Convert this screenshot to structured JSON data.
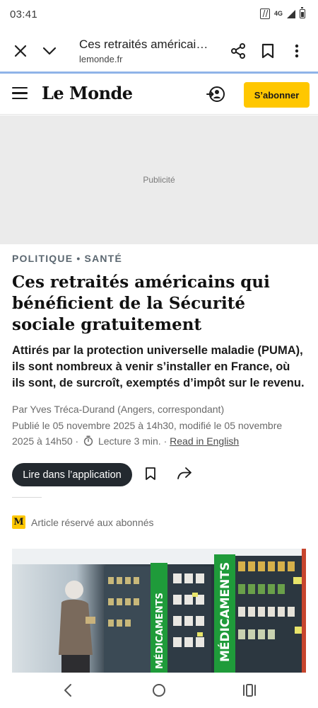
{
  "status_bar": {
    "time": "03:41",
    "network_label": "4G",
    "icons": [
      "nfc-icon",
      "signal-icon",
      "battery-icon"
    ]
  },
  "browser": {
    "tab_title": "Ces retraités américai…",
    "url": "lemonde.fr",
    "icons": [
      "close-icon",
      "chevron-down-icon",
      "share-icon",
      "bookmark-icon",
      "more-vert-icon"
    ]
  },
  "site_header": {
    "logo": "Le Monde",
    "subscribe_label": "S’abonner",
    "icons": [
      "hamburger-menu-icon",
      "account-login-icon"
    ]
  },
  "ad": {
    "label": "Publicité"
  },
  "article": {
    "kicker": "POLITIQUE • SANTÉ",
    "headline": "Ces retraités américains qui bénéficient de la Sécurité sociale gratuitement",
    "standfirst": "Attirés par la protection universelle maladie (PUMA), ils sont nombreux à venir s’installer en France, où ils sont, de surcroît, exemptés d’impôt sur le revenu.",
    "byline": "Par Yves Tréca-Durand (Angers, correspondant)",
    "published": "Publié le 05 novembre 2025 à 14h30, modifié le 05 novembre 2025 à 14h50",
    "separator": "·",
    "reading_time": "Lecture 3 min.",
    "read_in_english": "Read in English",
    "app_button_label": "Lire dans l’application",
    "subscriber_badge": "M",
    "subscriber_text": "Article réservé aux abonnés"
  },
  "photo": {
    "sign_left": "MÉDICAMENTS",
    "sign_right": "MÉDICAMENTS",
    "icons": [
      "pharmacy-shelf-image"
    ]
  },
  "nav_bar": {
    "icons": [
      "back-icon",
      "home-icon",
      "recents-icon"
    ]
  },
  "colors": {
    "accent_yellow": "#ffc700",
    "dark_button": "#23292f",
    "ad_background": "#ebebeb",
    "kicker": "#5b6770",
    "progress": "#8fb3e8",
    "pharmacy_green": "#1f9b3a"
  }
}
